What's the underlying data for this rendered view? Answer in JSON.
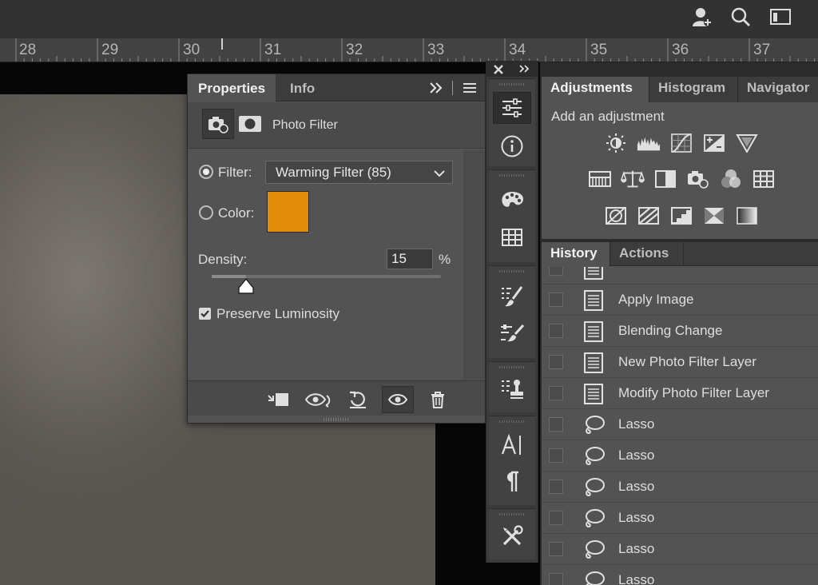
{
  "ruler": {
    "numbers": [
      "28",
      "29",
      "30",
      "31",
      "32",
      "33",
      "34",
      "35",
      "36",
      "37"
    ]
  },
  "properties": {
    "tabs": [
      "Properties",
      "Info"
    ],
    "header_title": "Photo Filter",
    "filter_label": "Filter:",
    "filter_value": "Warming Filter (85)",
    "color_label": "Color:",
    "color_value": "#e38c0a",
    "density_label": "Density:",
    "density_value": "15",
    "density_unit": "%",
    "density_fraction": 0.15,
    "preserve_label": "Preserve Luminosity",
    "preserve_checked": true
  },
  "adjustments": {
    "tabs": [
      "Adjustments",
      "Histogram",
      "Navigator"
    ],
    "add_label": "Add an adjustment"
  },
  "history": {
    "tabs": [
      "History",
      "Actions"
    ],
    "items": [
      {
        "label": "",
        "icon": "document-icon"
      },
      {
        "label": "Apply Image",
        "icon": "document-icon"
      },
      {
        "label": "Blending Change",
        "icon": "document-icon"
      },
      {
        "label": "New Photo Filter Layer",
        "icon": "document-icon"
      },
      {
        "label": "Modify Photo Filter Layer",
        "icon": "document-icon"
      },
      {
        "label": "Lasso",
        "icon": "lasso-icon"
      },
      {
        "label": "Lasso",
        "icon": "lasso-icon"
      },
      {
        "label": "Lasso",
        "icon": "lasso-icon"
      },
      {
        "label": "Lasso",
        "icon": "lasso-icon"
      },
      {
        "label": "Lasso",
        "icon": "lasso-icon"
      },
      {
        "label": "Lasso",
        "icon": "lasso-icon"
      }
    ]
  },
  "colors": {
    "accent": "#e38c0a",
    "panel": "#535353",
    "dark": "#2b2b2b"
  }
}
